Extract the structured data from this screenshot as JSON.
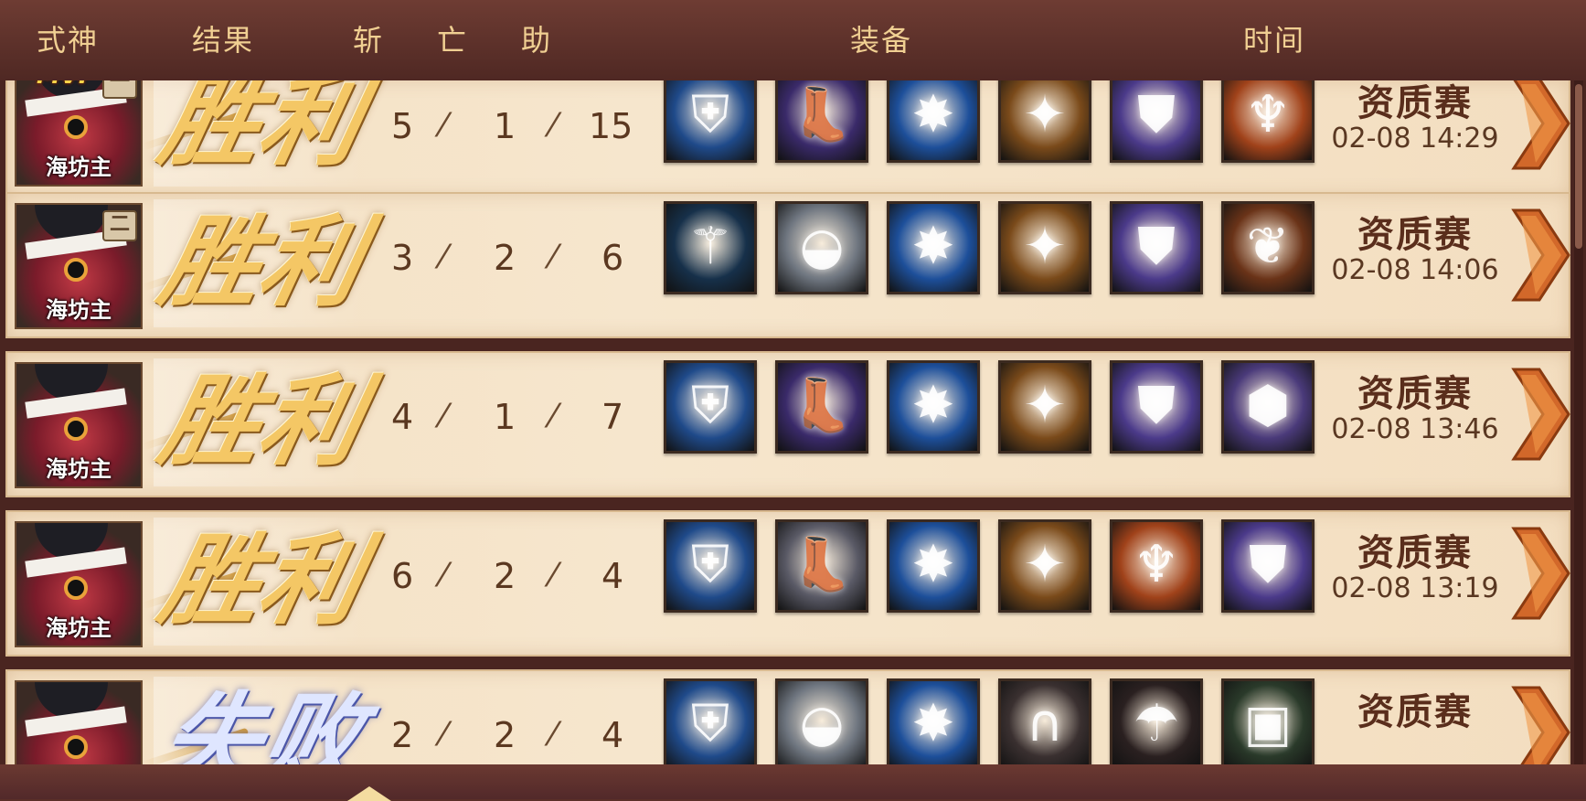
{
  "header": {
    "cols": [
      "式神",
      "结果",
      "斩",
      "亡",
      "助",
      "装备",
      "时间"
    ]
  },
  "rows": [
    {
      "mvp": "MVP",
      "rank": "一",
      "shikigami": "海坊主",
      "result": "胜利",
      "outcome": "win",
      "kills": "5",
      "deaths": "1",
      "assists": "15",
      "equipment": [
        {
          "icon": "armor-icon",
          "color": "#1f4a8a"
        },
        {
          "icon": "boots-icon",
          "color": "#3a2a6a"
        },
        {
          "icon": "fan-icon",
          "color": "#1d4f9a"
        },
        {
          "icon": "claw-icon",
          "color": "#7a4a1a"
        },
        {
          "icon": "shoulder-armor-icon",
          "color": "#4b3a8a"
        },
        {
          "icon": "robe-icon",
          "color": "#a0421a"
        }
      ],
      "mode": "资质赛",
      "time": "02-08 14:29"
    },
    {
      "mvp": "",
      "rank": "二",
      "shikigami": "海坊主",
      "result": "胜利",
      "outcome": "win",
      "kills": "3",
      "deaths": "2",
      "assists": "6",
      "equipment": [
        {
          "icon": "staff-icon",
          "color": "#16304a"
        },
        {
          "icon": "shoes-icon",
          "color": "#6f7680"
        },
        {
          "icon": "fan-icon",
          "color": "#1d4f9a"
        },
        {
          "icon": "claw-icon",
          "color": "#7a4a1a"
        },
        {
          "icon": "shoulder-armor-icon",
          "color": "#4b3a8a"
        },
        {
          "icon": "wing-armor-icon",
          "color": "#6a3318"
        }
      ],
      "mode": "资质赛",
      "time": "02-08 14:06"
    },
    {
      "mvp": "",
      "rank": "",
      "shikigami": "海坊主",
      "result": "胜利",
      "outcome": "win",
      "kills": "4",
      "deaths": "1",
      "assists": "7",
      "equipment": [
        {
          "icon": "armor-icon",
          "color": "#1f4a8a"
        },
        {
          "icon": "boots-icon",
          "color": "#3a2a6a"
        },
        {
          "icon": "fan-icon",
          "color": "#1d4f9a"
        },
        {
          "icon": "claw-icon",
          "color": "#7a4a1a"
        },
        {
          "icon": "shoulder-armor-icon",
          "color": "#4b3a8a"
        },
        {
          "icon": "shield-icon",
          "color": "#4a3a7a"
        }
      ],
      "mode": "资质赛",
      "time": "02-08 13:46"
    },
    {
      "mvp": "",
      "rank": "",
      "shikigami": "海坊主",
      "result": "胜利",
      "outcome": "win",
      "kills": "6",
      "deaths": "2",
      "assists": "4",
      "equipment": [
        {
          "icon": "armor-icon",
          "color": "#1f4a8a"
        },
        {
          "icon": "boots-icon",
          "color": "#5a5a66"
        },
        {
          "icon": "fan-icon",
          "color": "#1d4f9a"
        },
        {
          "icon": "claw-icon",
          "color": "#7a4a1a"
        },
        {
          "icon": "robe-icon",
          "color": "#a0421a"
        },
        {
          "icon": "shoulder-armor-icon",
          "color": "#4b3a8a"
        }
      ],
      "mode": "资质赛",
      "time": "02-08 13:19"
    },
    {
      "mvp": "",
      "rank": "",
      "shikigami": "",
      "result": "失败",
      "outcome": "loss",
      "kills": "2",
      "deaths": "2",
      "assists": "4",
      "equipment": [
        {
          "icon": "armor-icon",
          "color": "#1f4a8a"
        },
        {
          "icon": "shoes-icon",
          "color": "#6f7680"
        },
        {
          "icon": "fan-icon",
          "color": "#1d4f9a"
        },
        {
          "icon": "saddle-icon",
          "color": "#3a3030"
        },
        {
          "icon": "umbrella-icon",
          "color": "#2a2020"
        },
        {
          "icon": "tile-icon",
          "color": "#2a3a2a"
        }
      ],
      "mode": "资质赛",
      "time": ""
    }
  ]
}
